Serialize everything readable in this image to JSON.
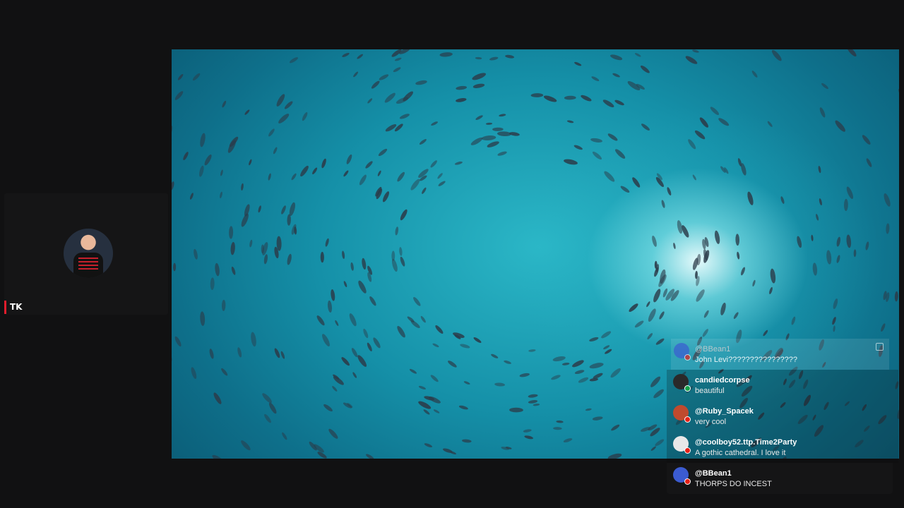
{
  "participant": {
    "name": "TK",
    "avatar": "participant-avatar",
    "indicator_color": "#e11d2c"
  },
  "stage": {
    "content": "video-feed",
    "colors": {
      "deep": "#0b5a74",
      "mid": "#1590a8",
      "light": "#2bb7c7",
      "fish": "#2b3c4a"
    }
  },
  "chat": {
    "messages": [
      {
        "user": "@BBean1",
        "text": "John Levi????????????????",
        "badge": "youtube",
        "avatar_color": "#3b5bd1"
      },
      {
        "user": "candiedcorpse",
        "text": "beautiful",
        "badge": "kick",
        "avatar_color": "#2a2a2a"
      },
      {
        "user": "@Ruby_Spacek",
        "text": "very cool",
        "badge": "youtube",
        "avatar_color": "#c04a2e"
      },
      {
        "user": "@coolboy52.ttp.Time2Party",
        "text": "A gothic cathedral. I love it",
        "badge": "youtube",
        "avatar_color": "#e8e8e8"
      },
      {
        "user": "@BBean1",
        "text": "THORPS DO INCEST",
        "badge": "youtube",
        "avatar_color": "#3b5bd1"
      }
    ],
    "report_icon": "report-flag-icon"
  }
}
